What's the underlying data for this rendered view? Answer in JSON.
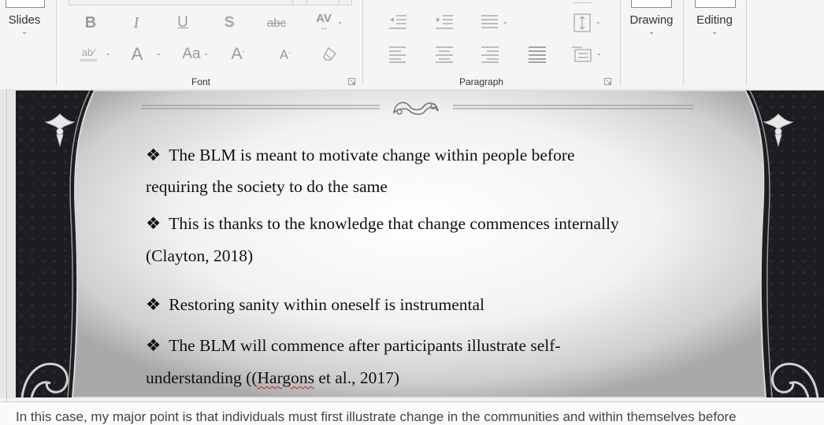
{
  "ribbon": {
    "slides_group": {
      "label": "Slides"
    },
    "font_group": {
      "label": "Font"
    },
    "paragraph_group": {
      "label": "Paragraph"
    },
    "drawing_group": {
      "label": "Drawing"
    },
    "editing_group": {
      "label": "Editing"
    },
    "icons": [
      "bold-icon",
      "italic-icon",
      "underline-icon",
      "shadow-icon",
      "strikethrough-icon",
      "character-spacing-icon",
      "highlight-icon",
      "font-color-icon",
      "change-case-icon",
      "increase-font-size-icon",
      "decrease-font-size-icon",
      "clear-formatting-icon",
      "decrease-indent-icon",
      "increase-indent-icon",
      "line-spacing-icon",
      "align-left-icon",
      "center-icon",
      "align-right-icon",
      "justify-icon",
      "columns-icon",
      "text-direction-icon",
      "align-text-icon"
    ]
  },
  "slide": {
    "bullets": [
      {
        "line1": "The BLM is meant to motivate change within people before",
        "line2": "requiring the society to do the same"
      },
      {
        "line1": "This is thanks to the knowledge that change commences internally",
        "line2": "(Clayton, 2018)"
      },
      {
        "line1": "Restoring sanity within oneself is instrumental"
      },
      {
        "line1": "The BLM will commence after participants illustrate self-",
        "line2_pre": "understanding ((",
        "line2_spell": "Hargons",
        "line2_post": " et al., 2017)"
      }
    ],
    "bullet_symbol": "❖"
  },
  "notes": {
    "text": "In this case, my major point is that individuals must first illustrate change in the communities and within themselves before"
  },
  "colors": {
    "ribbon_bg": "#f5f5f5",
    "slide_bg": "#1b1b20",
    "text": "#111111",
    "spell_error": "#d02020"
  }
}
